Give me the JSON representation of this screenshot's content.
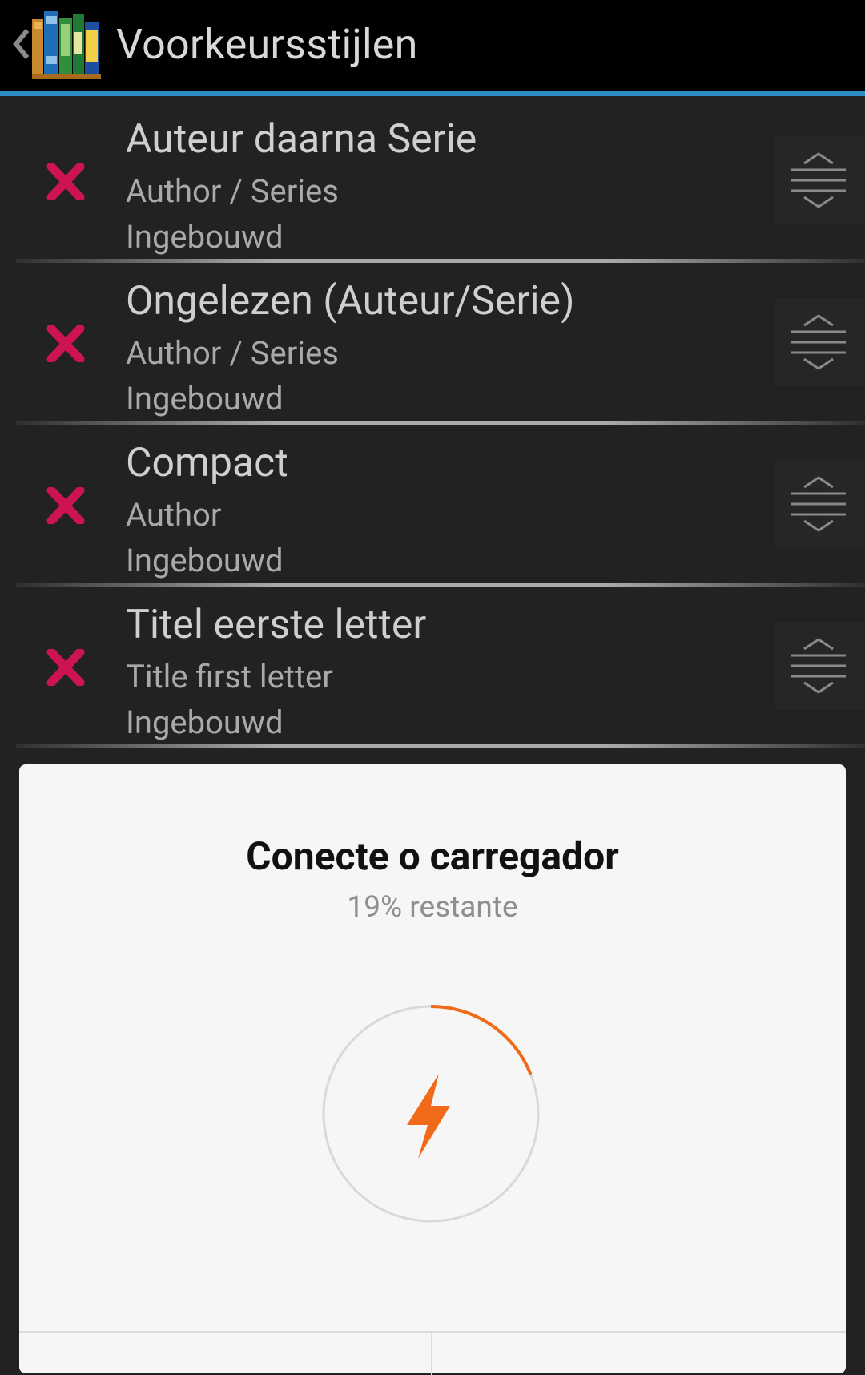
{
  "header": {
    "title": "Voorkeursstijlen",
    "back_icon": "chevron-left-icon",
    "logo_icon": "books-logo-icon"
  },
  "styles": [
    {
      "title": "Auteur daarna Serie",
      "subtitle": "Author / Series",
      "kind": "Ingebouwd"
    },
    {
      "title": "Ongelezen (Auteur/Serie)",
      "subtitle": "Author / Series",
      "kind": "Ingebouwd"
    },
    {
      "title": "Compact",
      "subtitle": "Author",
      "kind": "Ingebouwd"
    },
    {
      "title": "Titel eerste letter",
      "subtitle": "Title first letter",
      "kind": "Ingebouwd"
    }
  ],
  "dialog": {
    "title": "Conecte o carregador",
    "subtitle": "19% restante",
    "battery_fraction": 0.19,
    "icon": "lightning-bolt-icon",
    "buttons": [
      "",
      ""
    ]
  },
  "colors": {
    "accent": "#2f8fc4",
    "delete": "#cc1550",
    "battery": "#f06a1a",
    "ring_track": "#d9d9d9"
  }
}
